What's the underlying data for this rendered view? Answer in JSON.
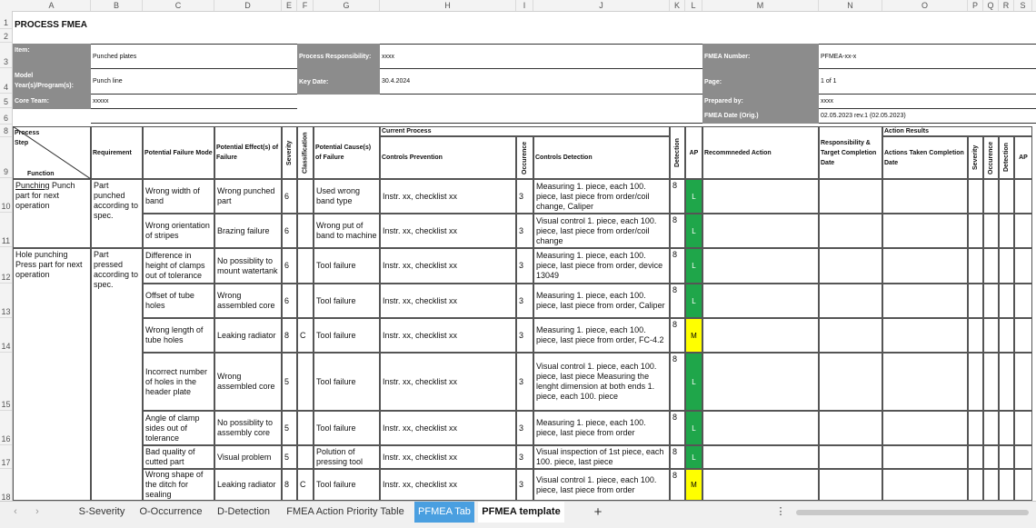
{
  "columns": [
    "A",
    "B",
    "C",
    "D",
    "E",
    "F",
    "G",
    "H",
    "I",
    "J",
    "K",
    "L",
    "M",
    "N",
    "O",
    "P",
    "Q",
    "R",
    "S"
  ],
  "rows": [
    "1",
    "2",
    "3",
    "4",
    "5",
    "6",
    "8",
    "9",
    "10",
    "11",
    "12",
    "13",
    "14",
    "15",
    "16",
    "17",
    "18"
  ],
  "header": {
    "title": "PROCESS FMEA",
    "item_label": "Item:",
    "item_value": "Punched plates",
    "model_label": "Model Year(s)/Program(s):",
    "model_value": "Punch line",
    "core_label": "Core Team:",
    "core_value": "xxxxx",
    "proc_resp_label": "Process Responsibility:",
    "proc_resp_value": "xxxx",
    "key_date_label": "Key Date:",
    "key_date_value": "30.4.2024",
    "fmea_num_label": "FMEA Number:",
    "fmea_num_value": "PFMEA-xx-x",
    "page_label": "Page:",
    "page_value": "1 of 1",
    "prepared_label": "Prepared by:",
    "prepared_value": "xxxx",
    "fmea_date_label": "FMEA Date (Orig.)",
    "fmea_date_value": "02.05.2023 rev.1 (02.05.2023)"
  },
  "table_headers": {
    "process_step": "Process Step",
    "function": "Function",
    "requirement": "Requirement",
    "failure_mode": "Potential Failure Mode",
    "effects": "Potential Effect(s) of Failure",
    "severity": "Severity",
    "classification": "Classification",
    "causes": "Potential Cause(s) of Failure",
    "current_process": "Current Process",
    "controls_prevention": "Controls Prevention",
    "occurence": "Occurence",
    "controls_detection": "Controls Detection",
    "detection": "Detection",
    "ap": "AP",
    "recommended": "Recommneded Action",
    "responsibility": "Responsibility & Target Completion Date",
    "action_results": "Action Results",
    "actions_taken": "Actions Taken Completion Date",
    "severity2": "Severity",
    "occurence2": "Occurence",
    "detection2": "Detection",
    "ap2": "AP"
  },
  "groups": [
    {
      "step_a": "Punching",
      "step_b": " Punch part for next operation",
      "requirement": "Part punched according to spec."
    },
    {
      "step": "Hole punching Press part for next operation",
      "requirement": "Part pressed according to spec."
    }
  ],
  "data_rows": [
    {
      "mode": "Wrong width of band",
      "effect": "Wrong punched part",
      "sev": "6",
      "cls": "",
      "cause": "Used wrong band type",
      "prev": "Instr. xx, checklist xx",
      "occ": "3",
      "det_ctrl": "Measuring 1. piece, each 100. piece, last piece from order/coil change, Caliper",
      "det": "8",
      "ap": "L"
    },
    {
      "mode": "Wrong orientation of stripes",
      "effect": "Brazing failure",
      "sev": "6",
      "cls": "",
      "cause": "Wrong put of band to machine",
      "prev": "Instr. xx, checklist xx",
      "occ": "3",
      "det_ctrl": "Visual control 1. piece, each 100. piece, last piece from order/coil change",
      "det": "8",
      "ap": "L"
    },
    {
      "mode": "Difference in height of clamps out of tolerance",
      "effect": "No possiblity to mount watertank",
      "sev": "6",
      "cls": "",
      "cause": "Tool failure",
      "prev": "Instr. xx, checklist xx",
      "occ": "3",
      "det_ctrl": "Measuring 1. piece, each 100. piece, last piece from order, device 13049",
      "det": "8",
      "ap": "L"
    },
    {
      "mode": "Offset of tube holes",
      "effect": "Wrong assembled core",
      "sev": "6",
      "cls": "",
      "cause": "Tool failure",
      "prev": "Instr. xx, checklist xx",
      "occ": "3",
      "det_ctrl": "Measuring 1. piece, each 100. piece, last piece from order, Caliper",
      "det": "8",
      "ap": "L"
    },
    {
      "mode": "Wrong length of tube holes",
      "effect": "Leaking radiator",
      "sev": "8",
      "cls": "C",
      "cause": "Tool failure",
      "prev": "Instr. xx, checklist xx",
      "occ": "3",
      "det_ctrl": "Measuring 1. piece, each 100. piece, last piece from order,  FC-4.2",
      "det": "8",
      "ap": "M"
    },
    {
      "mode": "Incorrect number of holes in the header plate",
      "effect": "Wrong assembled core",
      "sev": "5",
      "cls": "",
      "cause": "Tool failure",
      "prev": "Instr. xx, checklist xx",
      "occ": "3",
      "det_ctrl": "Visual control  1. piece, each 100. piece, last piece Measuring the lenght dimension at both ends 1. piece, each 100. piece",
      "det": "8",
      "ap": "L"
    },
    {
      "mode": "Angle of clamp sides out of tolerance",
      "effect": "No possiblity to assembly core",
      "sev": "5",
      "cls": "",
      "cause": "Tool failure",
      "prev": "Instr. xx, checklist xx",
      "occ": "3",
      "det_ctrl": "Measuring 1. piece, each 100. piece, last piece from order",
      "det": "8",
      "ap": "L"
    },
    {
      "mode": "Bad quality of cutted part",
      "effect": "Visual problem",
      "sev": "5",
      "cls": "",
      "cause": "Polution of pressing tool",
      "prev": "Instr. xx, checklist xx",
      "occ": "3",
      "det_ctrl": "Visual inspection of 1st piece, each 100. piece, last piece",
      "det": "8",
      "ap": "L"
    },
    {
      "mode": "Wrong shape of the ditch for sealing",
      "effect": "Leaking radiator",
      "sev": "8",
      "cls": "C",
      "cause": "Tool failure",
      "prev": "Instr. xx, checklist xx",
      "occ": "3",
      "det_ctrl": "Visual control 1. piece, each 100. piece, last piece from order",
      "det": "8",
      "ap": "M"
    }
  ],
  "tabs": [
    "S-Severity",
    "O-Occurrence",
    "D-Detection",
    "FMEA Action Priority Table",
    "PFMEA Tab",
    "PFMEA template"
  ],
  "nav": {
    "prev": "‹",
    "next": "›",
    "add": "+",
    "more": "⋮"
  },
  "colors": {
    "green": "#1fa64a",
    "yellow": "#ffff00",
    "tab_blue": "#4a9fe0",
    "gray": "#8c8c8c"
  }
}
